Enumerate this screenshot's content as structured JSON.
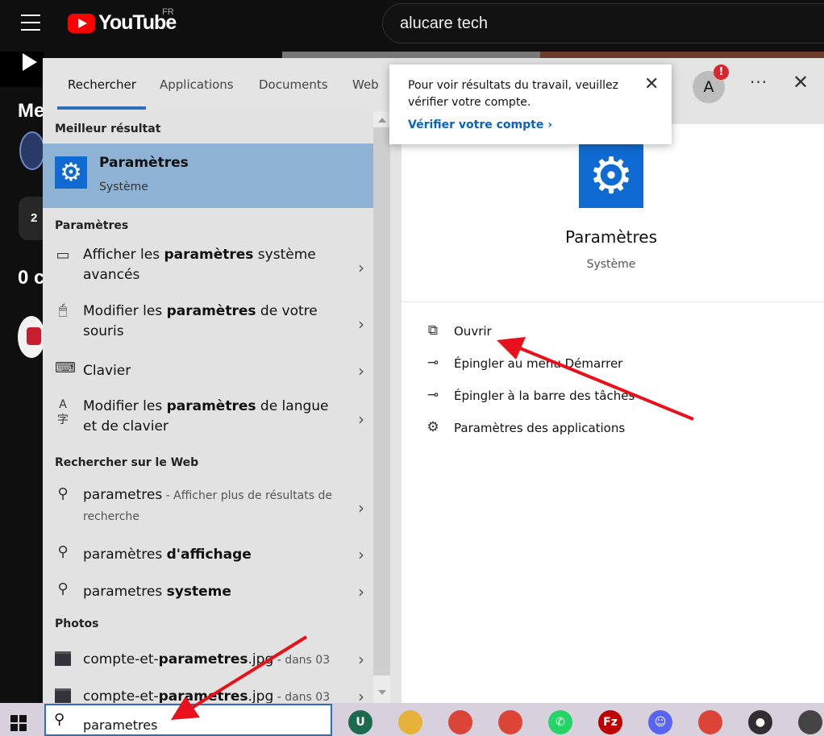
{
  "youtube": {
    "logo_text": "YouTube",
    "region": "FR",
    "search_query": "alucare tech",
    "heading_fragment": "Me",
    "chip_count": "2",
    "count_fragment": "0 c"
  },
  "search_panel": {
    "tabs": [
      {
        "label": "Rechercher",
        "active": true
      },
      {
        "label": "Applications",
        "active": false
      },
      {
        "label": "Documents",
        "active": false
      },
      {
        "label": "Web",
        "active": false
      }
    ],
    "account_initial": "A",
    "alert_glyph": "!",
    "more_glyph": "···",
    "close_glyph": "✕",
    "best_result": {
      "heading": "Meilleur résultat",
      "title": "Paramètres",
      "subtitle": "Système",
      "icon": "gear-icon"
    },
    "settings_section": {
      "heading": "Paramètres",
      "items": [
        {
          "pre": "Afficher les ",
          "bold": "paramètres",
          "post": " système avancés",
          "icon": "monitor-icon"
        },
        {
          "pre": "Modifier les ",
          "bold": "paramètres",
          "post": " de votre souris",
          "icon": "mouse-icon"
        },
        {
          "pre": "Clavier",
          "bold": "",
          "post": "",
          "icon": "keyboard-icon"
        },
        {
          "pre": "Modifier les ",
          "bold": "paramètres",
          "post": " de langue et de clavier",
          "icon": "language-icon"
        }
      ]
    },
    "web_section": {
      "heading": "Rechercher sur le Web",
      "items": [
        {
          "pre": "parametres",
          "bold": "",
          "post": "",
          "sub": " - Afficher plus de résultats de recherche"
        },
        {
          "pre": "paramètres ",
          "bold": "d'affichage",
          "post": "",
          "sub": ""
        },
        {
          "pre": "parametres ",
          "bold": "systeme",
          "post": "",
          "sub": ""
        }
      ]
    },
    "photos_section": {
      "heading": "Photos",
      "items": [
        {
          "pre": "compte-et-",
          "bold": "parametres",
          "post": ".jpg",
          "sub": " - dans 03"
        },
        {
          "pre": "compte-et-",
          "bold": "parametres",
          "post": ".jpg",
          "sub": " - dans 03"
        }
      ]
    },
    "detail": {
      "title": "Paramètres",
      "subtitle": "Système",
      "actions": [
        {
          "label": "Ouvrir",
          "icon": "open-icon"
        },
        {
          "label": "Épingler au menu Démarrer",
          "icon": "pin-start-icon"
        },
        {
          "label": "Épingler à la barre des tâches",
          "icon": "pin-taskbar-icon"
        },
        {
          "label": "Paramètres des applications",
          "icon": "gear-icon"
        }
      ]
    },
    "popup": {
      "message": "Pour voir résultats du travail, veuillez vérifier votre compte.",
      "link": "Vérifier votre compte"
    }
  },
  "taskbar": {
    "search_text": "parametres",
    "apps": [
      {
        "name": "upwork-icon",
        "glyph": "U",
        "color": "#1d6b4f"
      },
      {
        "name": "file-explorer-icon",
        "glyph": "",
        "color": "#e7b23a"
      },
      {
        "name": "chrome-icon",
        "glyph": "",
        "color": "#db4437"
      },
      {
        "name": "chrome-icon-2",
        "glyph": "",
        "color": "#db4437"
      },
      {
        "name": "whatsapp-icon",
        "glyph": "✆",
        "color": "#25d366"
      },
      {
        "name": "filezilla-icon",
        "glyph": "Fz",
        "color": "#bf0000"
      },
      {
        "name": "discord-icon",
        "glyph": "☺",
        "color": "#5865f2"
      },
      {
        "name": "chrome-icon-3",
        "glyph": "",
        "color": "#db4437"
      },
      {
        "name": "obs-icon",
        "glyph": "●",
        "color": "#302e31"
      },
      {
        "name": "media-app-icon",
        "glyph": "",
        "color": "#444444"
      }
    ]
  },
  "colors": {
    "accent": "#2f6eba",
    "settings_blue": "#0f6bd1",
    "selected_row": "#8fb3d4",
    "arrow_red": "#e8101a",
    "youtube_red": "#ff0000"
  }
}
